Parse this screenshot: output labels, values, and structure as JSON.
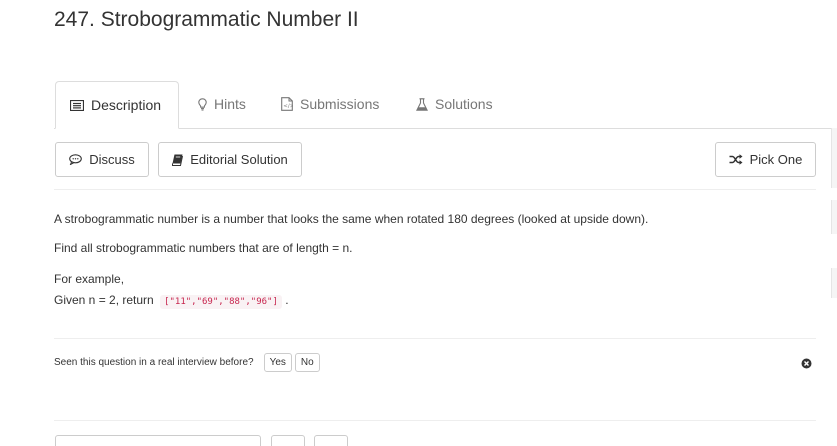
{
  "page": {
    "title": "247. Strobogrammatic Number II"
  },
  "tabs": [
    {
      "label": "Description",
      "icon": "list-icon",
      "active": true
    },
    {
      "label": "Hints",
      "icon": "lightbulb-icon",
      "active": false
    },
    {
      "label": "Submissions",
      "icon": "submissions-icon",
      "active": false
    },
    {
      "label": "Solutions",
      "icon": "flask-icon",
      "active": false
    }
  ],
  "toolbar": {
    "discuss_label": "Discuss",
    "editorial_label": "Editorial Solution",
    "pick_one_label": "Pick One"
  },
  "problem": {
    "line1": "A strobogrammatic number is a number that looks the same when rotated 180 degrees (looked at upside down).",
    "line2": "Find all strobogrammatic numbers that are of length = n.",
    "line3": "For example,",
    "line4_prefix": "Given n = 2, return",
    "line4_code": "[\"11\",\"69\",\"88\",\"96\"]",
    "line4_suffix": "."
  },
  "interview_question": {
    "prompt": "Seen this question in a real interview before?",
    "yes_label": "Yes",
    "no_label": "No"
  },
  "colors": {
    "code_text": "#c7254e",
    "code_bg": "#f9f2f4",
    "border": "#dddddd"
  }
}
